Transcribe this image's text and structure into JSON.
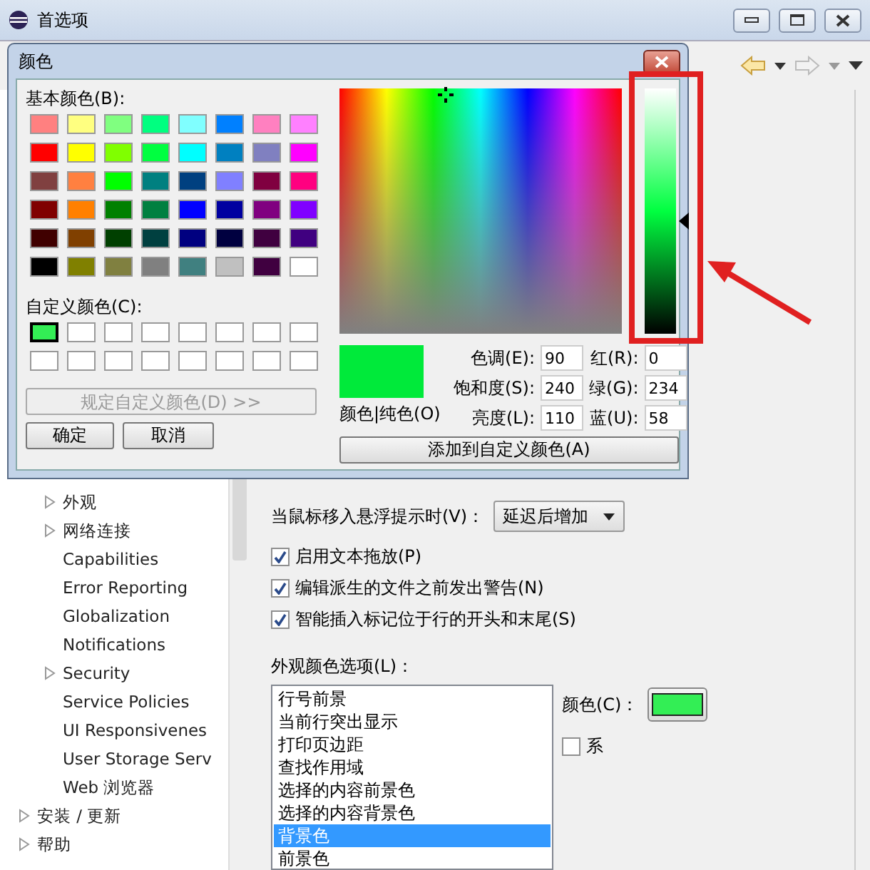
{
  "window": {
    "title": "首选项"
  },
  "tree": [
    {
      "children": [
        {
          "label": "外观",
          "expandable": true
        },
        {
          "label": "网络连接",
          "expandable": true
        },
        {
          "label": "Capabilities",
          "expandable": false
        },
        {
          "label": "Error Reporting",
          "expandable": false
        },
        {
          "label": "Globalization",
          "expandable": false
        },
        {
          "label": "Notifications",
          "expandable": false
        },
        {
          "label": "Security",
          "expandable": true
        },
        {
          "label": "Service Policies",
          "expandable": false
        },
        {
          "label": "UI Responsivenes",
          "expandable": false
        },
        {
          "label": "User Storage Serv",
          "expandable": false
        },
        {
          "label": "Web 浏览器",
          "expandable": false
        }
      ]
    },
    {
      "label": "安装 / 更新",
      "expandable": true
    },
    {
      "label": "帮助",
      "expandable": true
    }
  ],
  "editor": {
    "hover_label": "当鼠标移入悬浮提示时(V)：",
    "hover_value": "延迟后增加",
    "options": [
      {
        "label": "启用文本拖放(P)",
        "checked": true
      },
      {
        "label": "编辑派生的文件之前发出警告(N)",
        "checked": true
      },
      {
        "label": "智能插入标记位于行的开头和末尾(S)",
        "checked": true
      }
    ],
    "appearance_label": "外观颜色选项(L)：",
    "color_items": [
      {
        "label": "行号前景",
        "selected": false
      },
      {
        "label": "当前行突出显示",
        "selected": false
      },
      {
        "label": "打印页边距",
        "selected": false
      },
      {
        "label": "查找作用域",
        "selected": false
      },
      {
        "label": "选择的内容前景色",
        "selected": false
      },
      {
        "label": "选择的内容背景色",
        "selected": false
      },
      {
        "label": "背景色",
        "selected": true
      },
      {
        "label": "前景色",
        "selected": false
      }
    ],
    "color_label": "颜色(C)：",
    "color_button": {
      "color": "#33ee55"
    },
    "system_default": {
      "label": "系",
      "checked": false
    }
  },
  "color_dialog": {
    "title": "颜色",
    "basic_label": "基本颜色(B):",
    "basic_colors": [
      {
        "color": "#ff8080"
      },
      {
        "color": "#ffff80"
      },
      {
        "color": "#80ff80"
      },
      {
        "color": "#00ff80"
      },
      {
        "color": "#80ffff"
      },
      {
        "color": "#0080ff"
      },
      {
        "color": "#ff80c0"
      },
      {
        "color": "#ff80ff"
      },
      {
        "color": "#ff0000"
      },
      {
        "color": "#ffff00"
      },
      {
        "color": "#80ff00"
      },
      {
        "color": "#00ff40"
      },
      {
        "color": "#00ffff"
      },
      {
        "color": "#0080c0"
      },
      {
        "color": "#8080c0"
      },
      {
        "color": "#ff00ff"
      },
      {
        "color": "#804040"
      },
      {
        "color": "#ff8040"
      },
      {
        "color": "#00ff00"
      },
      {
        "color": "#008080"
      },
      {
        "color": "#004080"
      },
      {
        "color": "#8080ff"
      },
      {
        "color": "#800040"
      },
      {
        "color": "#ff0080"
      },
      {
        "color": "#800000"
      },
      {
        "color": "#ff8000"
      },
      {
        "color": "#008000"
      },
      {
        "color": "#008040"
      },
      {
        "color": "#0000ff"
      },
      {
        "color": "#0000a0"
      },
      {
        "color": "#800080"
      },
      {
        "color": "#8000ff"
      },
      {
        "color": "#400000"
      },
      {
        "color": "#804000"
      },
      {
        "color": "#004000"
      },
      {
        "color": "#004040"
      },
      {
        "color": "#000080"
      },
      {
        "color": "#000040"
      },
      {
        "color": "#400040"
      },
      {
        "color": "#400080"
      },
      {
        "color": "#000000"
      },
      {
        "color": "#808000"
      },
      {
        "color": "#808040"
      },
      {
        "color": "#808080"
      },
      {
        "color": "#408080"
      },
      {
        "color": "#c0c0c0"
      },
      {
        "color": "#400040"
      },
      {
        "color": "#ffffff"
      }
    ],
    "custom_label": "自定义颜色(C):",
    "custom_colors": [
      {
        "color": "#33ee55",
        "selected": true
      },
      {
        "color": "#ffffff",
        "selected": false
      },
      {
        "color": "#ffffff",
        "selected": false
      },
      {
        "color": "#ffffff",
        "selected": false
      },
      {
        "color": "#ffffff",
        "selected": false
      },
      {
        "color": "#ffffff",
        "selected": false
      },
      {
        "color": "#ffffff",
        "selected": false
      },
      {
        "color": "#ffffff",
        "selected": false
      },
      {
        "color": "#ffffff",
        "selected": false
      },
      {
        "color": "#ffffff",
        "selected": false
      },
      {
        "color": "#ffffff",
        "selected": false
      },
      {
        "color": "#ffffff",
        "selected": false
      },
      {
        "color": "#ffffff",
        "selected": false
      },
      {
        "color": "#ffffff",
        "selected": false
      },
      {
        "color": "#ffffff",
        "selected": false
      },
      {
        "color": "#ffffff",
        "selected": false
      }
    ],
    "define_button": {
      "label": "规定自定义颜色(D) >>",
      "disabled": true
    },
    "ok_button": "确定",
    "cancel_button": "取消",
    "luminance": {
      "level": 0.46
    },
    "preview_label": "颜色|纯色(O)",
    "fields": [
      {
        "label": "色调(E):",
        "value": "90"
      },
      {
        "label": "红(R):",
        "value": "0"
      },
      {
        "label": "饱和度(S):",
        "value": "240"
      },
      {
        "label": "绿(G):",
        "value": "234"
      },
      {
        "label": "亮度(L):",
        "value": "110"
      },
      {
        "label": "蓝(U):",
        "value": "58"
      }
    ],
    "add_button": "添加到自定义颜色(A)"
  }
}
